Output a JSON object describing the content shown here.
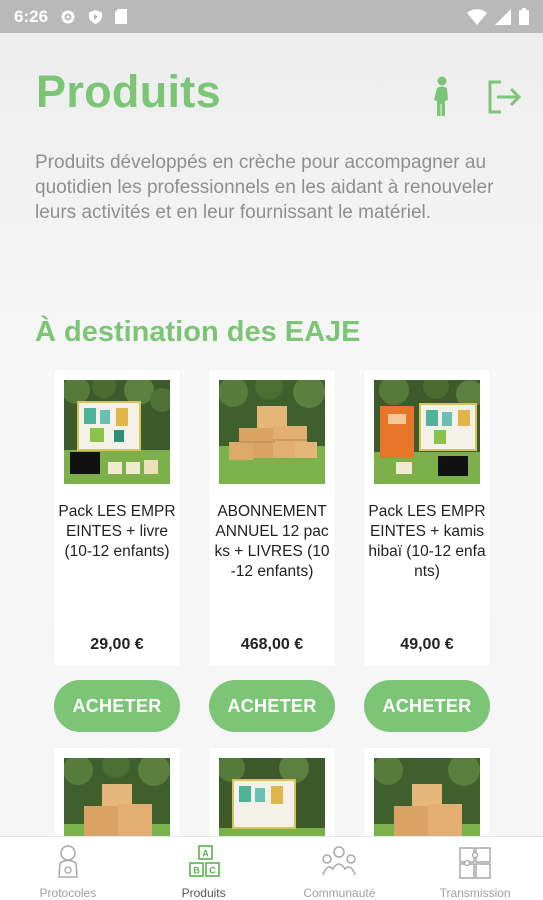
{
  "status_bar": {
    "time": "6:26"
  },
  "header": {
    "title": "Produits"
  },
  "intro_text": "Produits développés en crèche pour accompagner au quotidien les professionnels en les aidant à renouveler leurs activités et en leur fournissant le matériel.",
  "section": {
    "title": "À destination des EAJE"
  },
  "products": [
    {
      "name": "Pack LES EMPREINTES + livre (10-12 enfants)",
      "price": "29,00 €",
      "button": "ACHETER",
      "image": "board-with-cards"
    },
    {
      "name": "ABONNEMENT ANNUEL 12 packs + LIVRES (10-12 enfants)",
      "price": "468,00 €",
      "button": "ACHETER",
      "image": "stacked-boxes"
    },
    {
      "name": "Pack LES EMPREINTES + kamishibaï (10-12 enfants)",
      "price": "49,00 €",
      "button": "ACHETER",
      "image": "orange-kamishibai"
    }
  ],
  "nav": [
    {
      "label": "Protocoles",
      "icon": "baby-icon"
    },
    {
      "label": "Produits",
      "icon": "abc-blocks-icon"
    },
    {
      "label": "Communauté",
      "icon": "community-icon"
    },
    {
      "label": "Transmission",
      "icon": "puzzle-icon"
    }
  ],
  "colors": {
    "accent": "#7cc576",
    "text_muted": "#8f8f8f"
  }
}
